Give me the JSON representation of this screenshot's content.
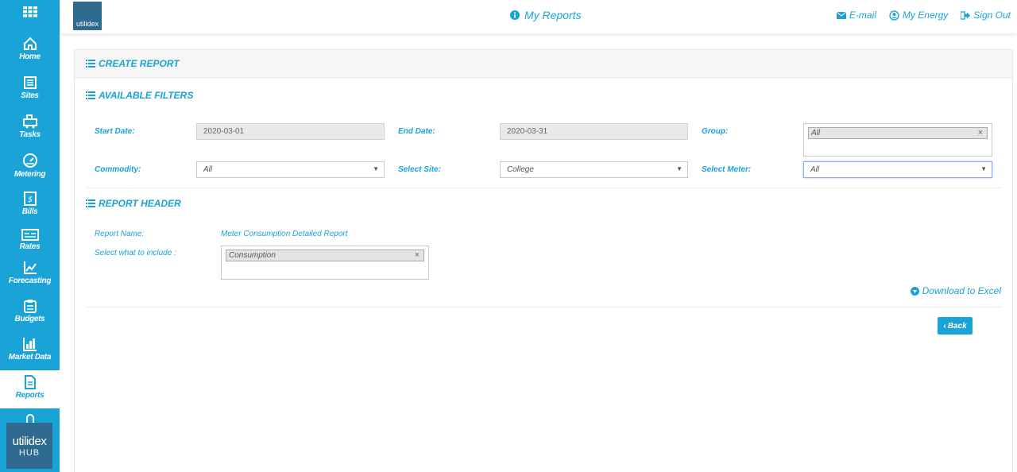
{
  "sidebar": {
    "items": [
      {
        "label": "Home",
        "icon": "home-icon"
      },
      {
        "label": "Sites",
        "icon": "sites-icon"
      },
      {
        "label": "Tasks",
        "icon": "tasks-icon"
      },
      {
        "label": "Metering",
        "icon": "gauge-icon"
      },
      {
        "label": "Bills",
        "icon": "bill-icon"
      },
      {
        "label": "Rates",
        "icon": "rates-icon"
      },
      {
        "label": "Forecasting",
        "icon": "chart-line-icon"
      },
      {
        "label": "Budgets",
        "icon": "clipboard-icon"
      },
      {
        "label": "Market Data",
        "icon": "bar-chart-icon"
      },
      {
        "label": "Reports",
        "icon": "document-icon",
        "active": true
      }
    ],
    "hub_logo": {
      "line1": "utilidex",
      "line2": "HUB"
    }
  },
  "header": {
    "brand": "utilidex",
    "title": "My Reports",
    "links": {
      "email": "E-mail",
      "my_energy": "My Energy",
      "sign_out": "Sign Out"
    }
  },
  "panel": {
    "title": "CREATE REPORT",
    "filters": {
      "title": "AVAILABLE FILTERS",
      "start_date_label": "Start Date:",
      "start_date_value": "2020-03-01",
      "end_date_label": "End Date:",
      "end_date_value": "2020-03-31",
      "group_label": "Group:",
      "group_value": "All",
      "commodity_label": "Commodity:",
      "commodity_value": "All",
      "site_label": "Select Site:",
      "site_value": "College",
      "meter_label": "Select Meter:",
      "meter_value": "All"
    },
    "report_header": {
      "title": "REPORT HEADER",
      "name_label": "Report Name:",
      "name_value": "Meter Consumption Detailed Report",
      "include_label": "Select what to include :",
      "include_value": "Consumption"
    },
    "download_label": "Download to Excel",
    "back_label": "Back"
  },
  "colors": {
    "accent": "#1aa3d6",
    "logo": "#2f6b8f"
  }
}
